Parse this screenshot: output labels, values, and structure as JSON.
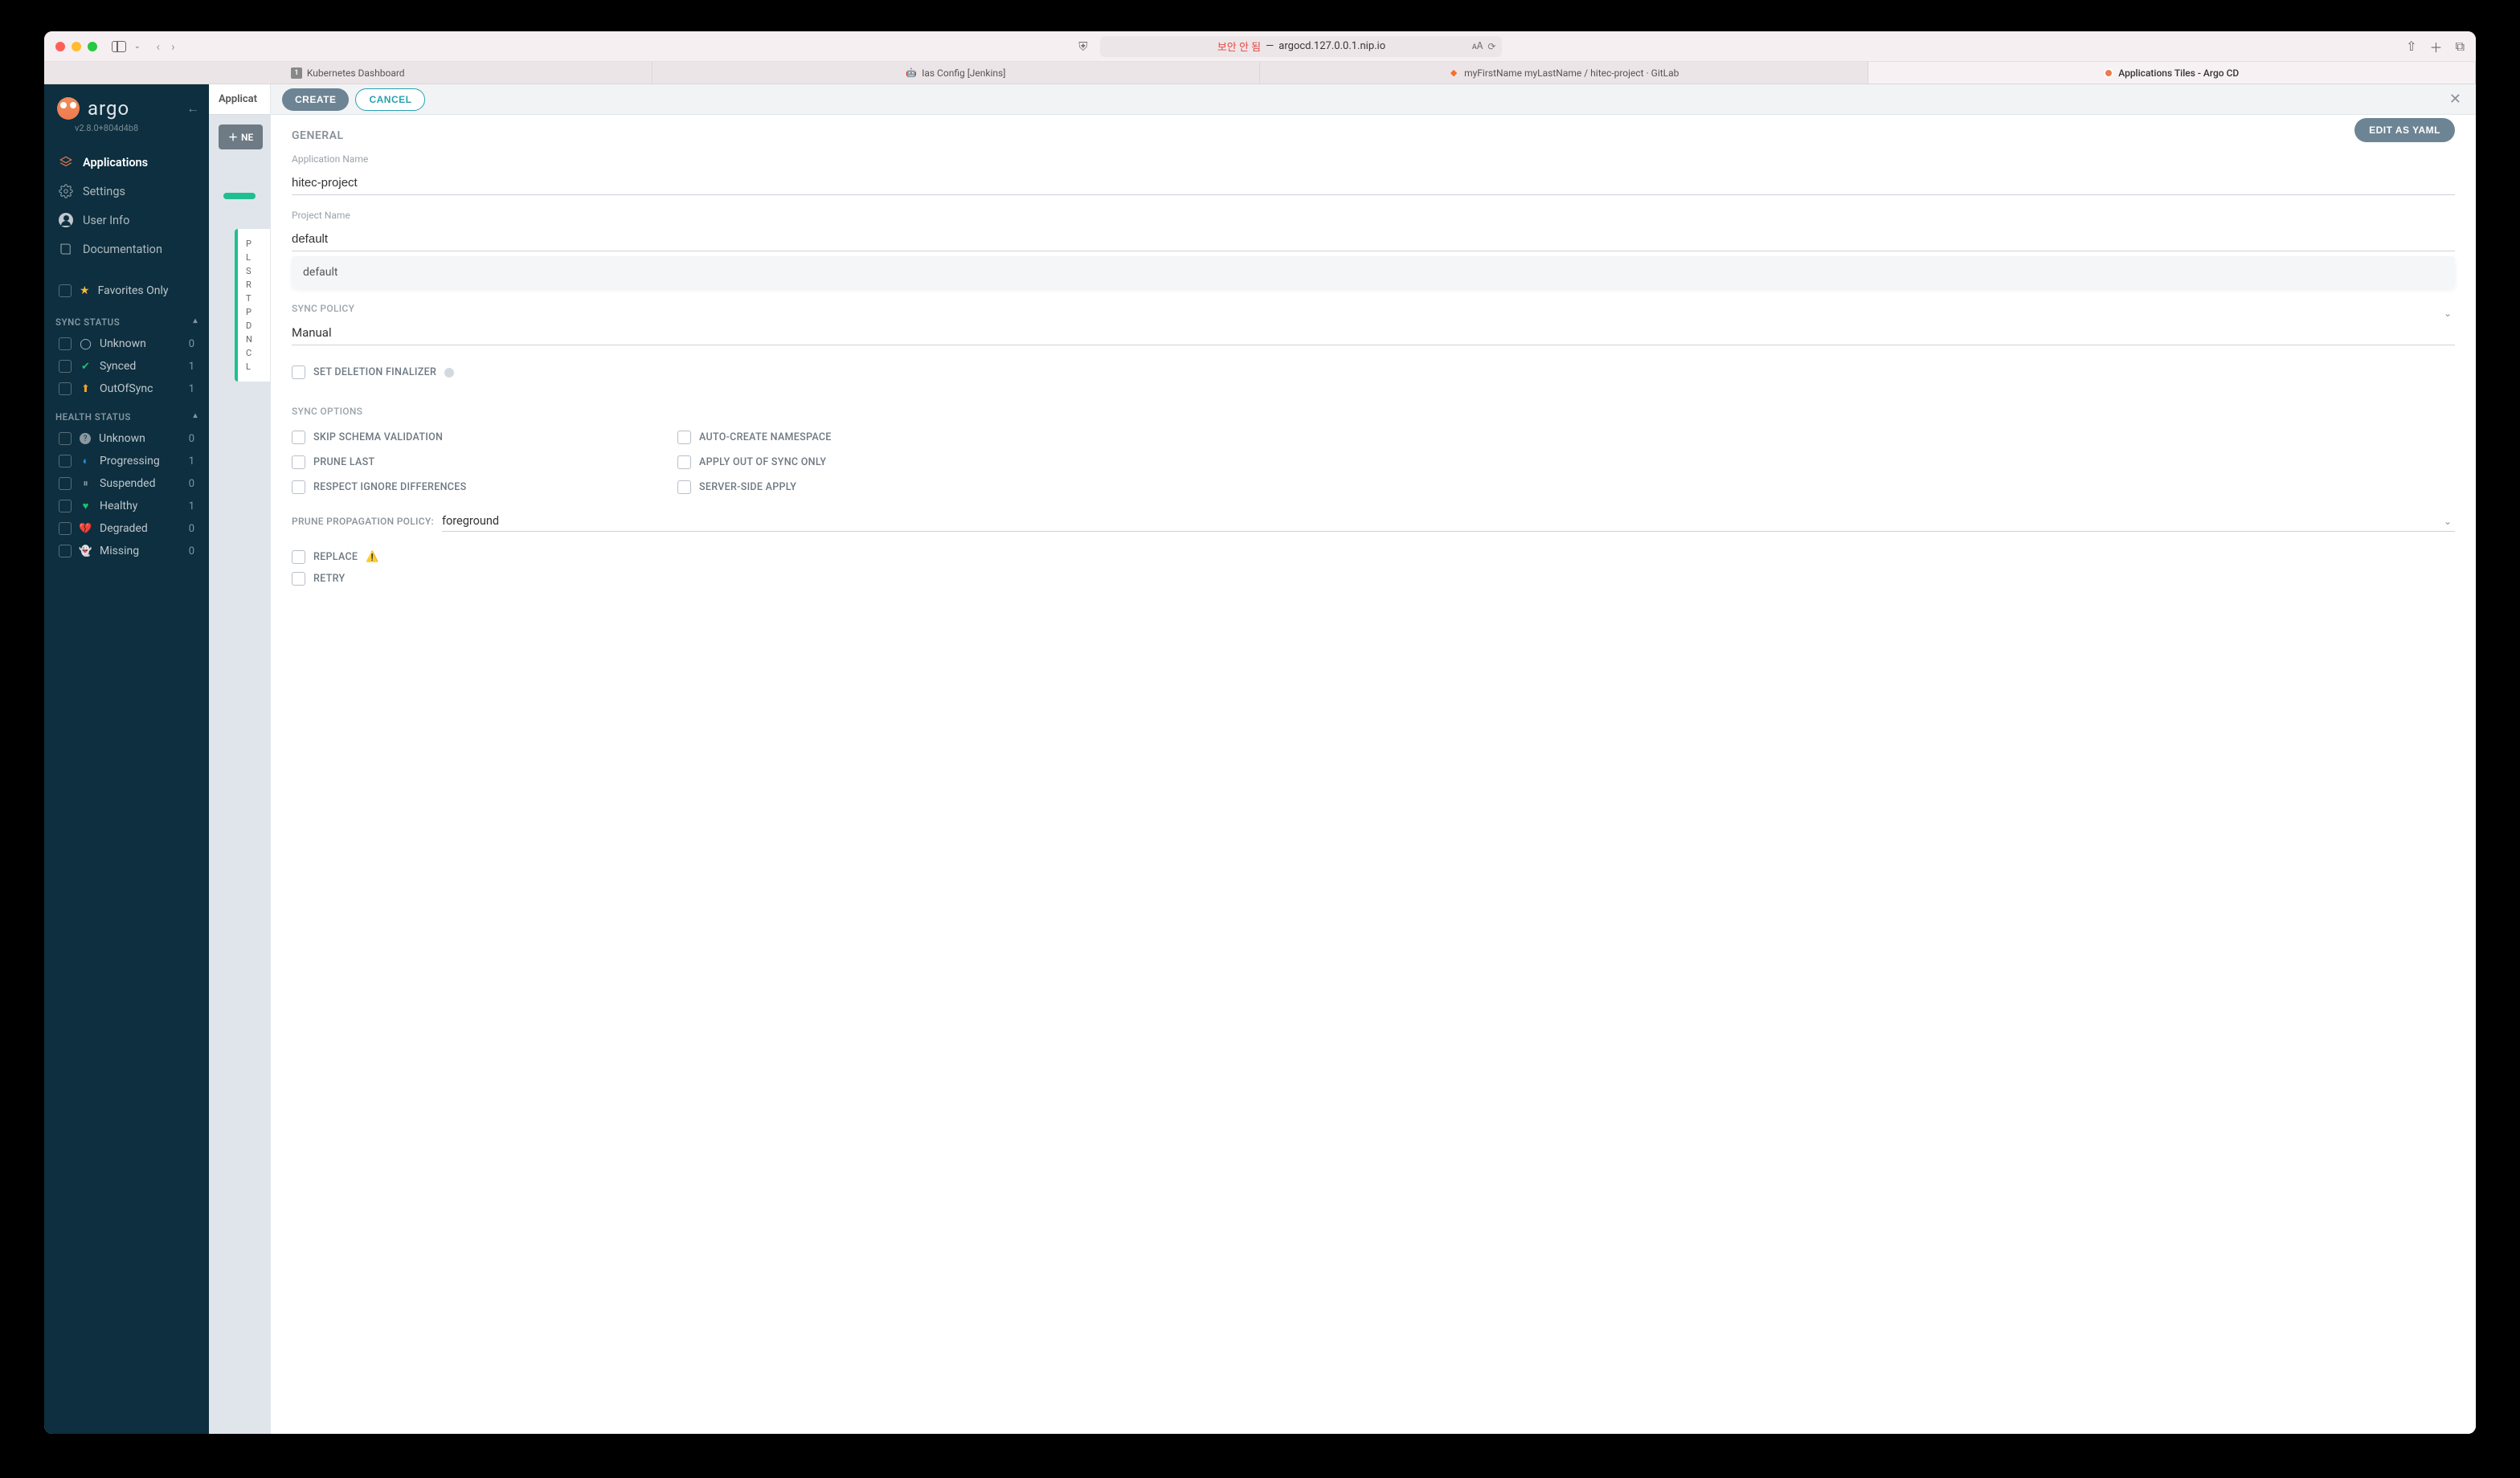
{
  "browser": {
    "url_insecure_label": "보안 안 됨",
    "url_separator": " — ",
    "url_host": "argocd.127.0.0.1.nip.io",
    "tabs": [
      {
        "label": "Kubernetes Dashboard"
      },
      {
        "label": "Ias Config [Jenkins]"
      },
      {
        "label": "myFirstName myLastName / hitec-project · GitLab"
      },
      {
        "label": "Applications Tiles - Argo CD"
      }
    ]
  },
  "sidebar": {
    "brand": "argo",
    "version": "v2.8.0+804d4b8",
    "nav": {
      "applications": "Applications",
      "settings": "Settings",
      "user_info": "User Info",
      "documentation": "Documentation"
    },
    "favorites_only": "Favorites Only",
    "sync_status_title": "SYNC STATUS",
    "sync_status": [
      {
        "label": "Unknown",
        "count": "0",
        "color": "#b8c0c8"
      },
      {
        "label": "Synced",
        "count": "1",
        "color": "#1fbf75"
      },
      {
        "label": "OutOfSync",
        "count": "1",
        "color": "#f5a623"
      }
    ],
    "health_status_title": "HEALTH STATUS",
    "health_status": [
      {
        "label": "Unknown",
        "count": "0",
        "icon": "?",
        "color": "#8a98a2"
      },
      {
        "label": "Progressing",
        "count": "1",
        "icon": "◐",
        "color": "#2b8dd6"
      },
      {
        "label": "Suspended",
        "count": "0",
        "icon": "⏸",
        "color": "#8a98a2"
      },
      {
        "label": "Healthy",
        "count": "1",
        "icon": "♥",
        "color": "#1fbf75"
      },
      {
        "label": "Degraded",
        "count": "0",
        "icon": "💔",
        "color": "#e34943"
      },
      {
        "label": "Missing",
        "count": "0",
        "icon": "👻",
        "color": "#f5b83d"
      }
    ]
  },
  "background": {
    "breadcrumb": "Applicat",
    "new_app_btn": "NE",
    "card_rows": [
      "P",
      "L",
      "S",
      "R",
      "T",
      "P",
      "D",
      "N",
      "C",
      "L"
    ]
  },
  "modal": {
    "create": "CREATE",
    "cancel": "CANCEL",
    "edit_yaml": "EDIT AS YAML",
    "general_heading": "GENERAL",
    "app_name_label": "Application Name",
    "app_name_value": "hitec-project",
    "project_name_label": "Project Name",
    "project_name_value": "default",
    "project_suggestion": "default",
    "sync_policy_label": "SYNC POLICY",
    "sync_policy_value": "Manual",
    "set_deletion_finalizer": "SET DELETION FINALIZER",
    "sync_options_heading": "SYNC OPTIONS",
    "options": {
      "skip_schema": "SKIP SCHEMA VALIDATION",
      "auto_create_ns": "AUTO-CREATE NAMESPACE",
      "prune_last": "PRUNE LAST",
      "apply_oos": "APPLY OUT OF SYNC ONLY",
      "respect_ignore": "RESPECT IGNORE DIFFERENCES",
      "server_side": "SERVER-SIDE APPLY"
    },
    "prune_propagation_label": "PRUNE PROPAGATION POLICY:",
    "prune_propagation_value": "foreground",
    "replace": "REPLACE",
    "retry": "RETRY"
  }
}
